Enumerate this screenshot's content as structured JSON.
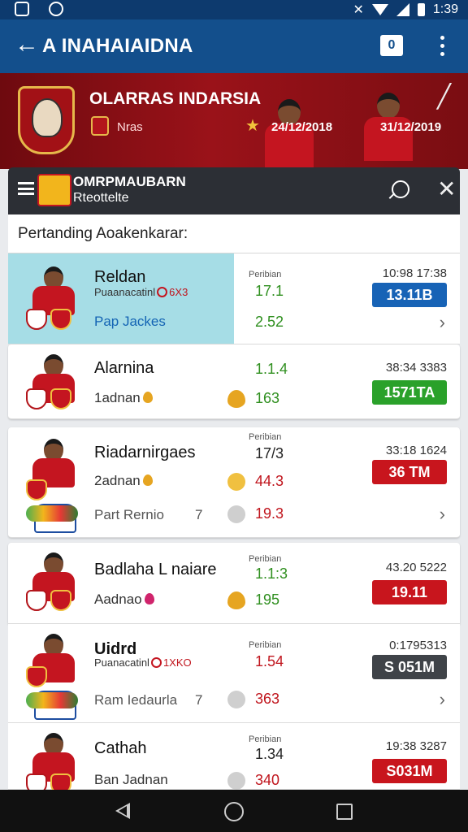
{
  "status_bar": {
    "time": "1:39"
  },
  "app_bar": {
    "title": "A INAHAIAIDNA",
    "square_label": "0"
  },
  "banner": {
    "title": "OLARRAS INDARSIA",
    "subtitle": "Nras",
    "date_left": "24/12/2018",
    "date_right": "31/12/2019"
  },
  "toolbar": {
    "line1": "OMRPMAUBARN",
    "line2": "Rteottelte"
  },
  "section": {
    "title": "Pertanding Aoakenkarar:"
  },
  "matches": [
    {
      "name": "Reldan",
      "detail": "Puaanacatinl",
      "detail_code": "6X3",
      "sub": "Pap Jackes",
      "label": "Peribian",
      "odd1": "17.1",
      "odd2": "2.52",
      "time": "10:98 17:38",
      "badge": "13.11B",
      "badge_color": "#1763b6"
    },
    {
      "name": "Alarnina",
      "sub": "1adnan",
      "odd1": "1.1.4",
      "odd2": "163",
      "time": "38:34 3383",
      "badge": "1571TA",
      "badge_color": "#2aa12a"
    },
    {
      "name": "Riadarnirgaes",
      "sub": "2adnan",
      "extra": "Part Rernio",
      "seven": "7",
      "label": "Peribian",
      "odd1": "17/3",
      "odd2": "44.3",
      "odd3": "19.3",
      "time": "33:18 1624",
      "badge": "36 TM",
      "badge_color": "#c8151d"
    },
    {
      "name": "Badlaha L naiare",
      "sub": "Aadnao",
      "label": "Peribian",
      "odd1": "1.1:3",
      "odd2": "195",
      "time": "43.20 5222",
      "badge": "19.11",
      "badge_color": "#c8151d"
    },
    {
      "name": "Uidrd",
      "detail": "Puanacatinl",
      "detail_code": "1XKO",
      "extra": "Ram Iedaurla",
      "seven": "7",
      "label": "Peribian",
      "odd1": "1.54",
      "odd2": "363",
      "time": "0:1795313",
      "badge": "S 051M",
      "badge_color": "#3f4348"
    },
    {
      "name": "Cathah",
      "sub": "Ban Jadnan",
      "label": "Peribian",
      "odd1": "1.34",
      "odd2": "340",
      "time": "19:38 3287",
      "badge": "S031M",
      "badge_color": "#c8151d"
    }
  ]
}
